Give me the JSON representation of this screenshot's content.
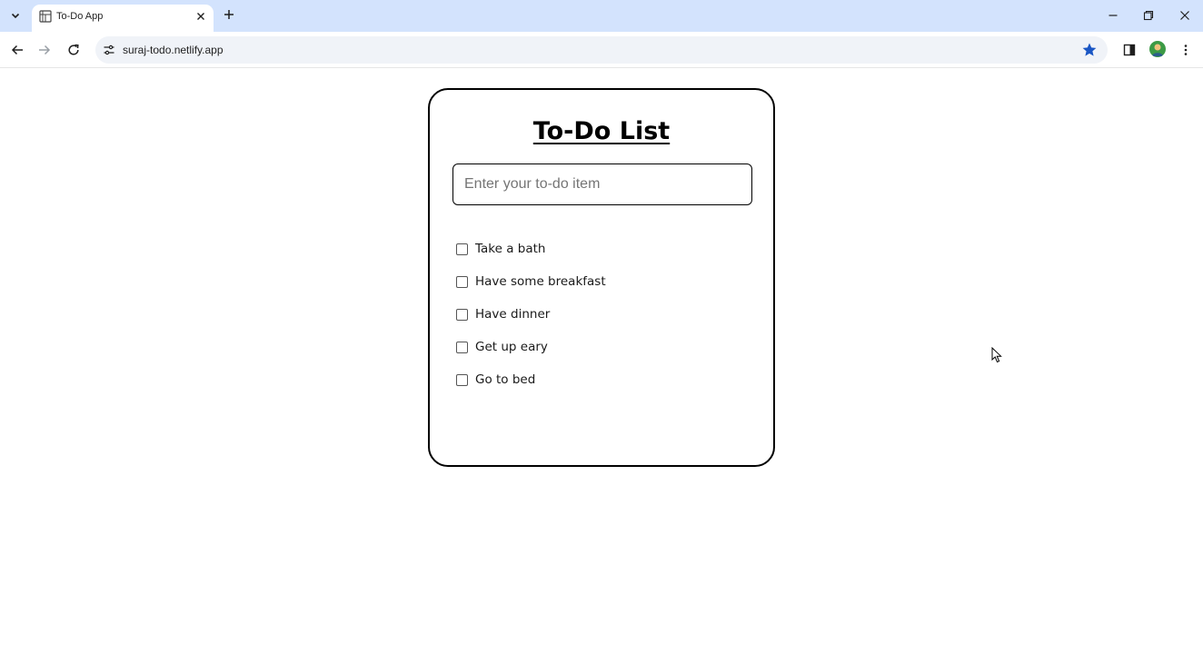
{
  "browser": {
    "tab": {
      "title": "To-Do App"
    },
    "url": "suraj-todo.netlify.app"
  },
  "app": {
    "title": "To-Do List",
    "input": {
      "placeholder": "Enter your to-do item",
      "value": ""
    },
    "items": [
      {
        "label": "Take a bath",
        "checked": false
      },
      {
        "label": "Have some breakfast",
        "checked": false
      },
      {
        "label": "Have dinner",
        "checked": false
      },
      {
        "label": "Get up eary",
        "checked": false
      },
      {
        "label": "Go to bed",
        "checked": false
      }
    ]
  },
  "colors": {
    "tabbar_bg": "#d3e3fd",
    "bookmark_star": "#1a56c4",
    "avatar": "#3c9a45"
  },
  "icons": [
    "tab-list-icon",
    "favicon-icon",
    "close-icon",
    "plus-icon",
    "minimize-icon",
    "restore-icon",
    "back-icon",
    "forward-icon",
    "reload-icon",
    "site-info-icon",
    "star-icon",
    "side-panel-icon",
    "avatar",
    "more-vert-icon",
    "cursor-icon"
  ]
}
